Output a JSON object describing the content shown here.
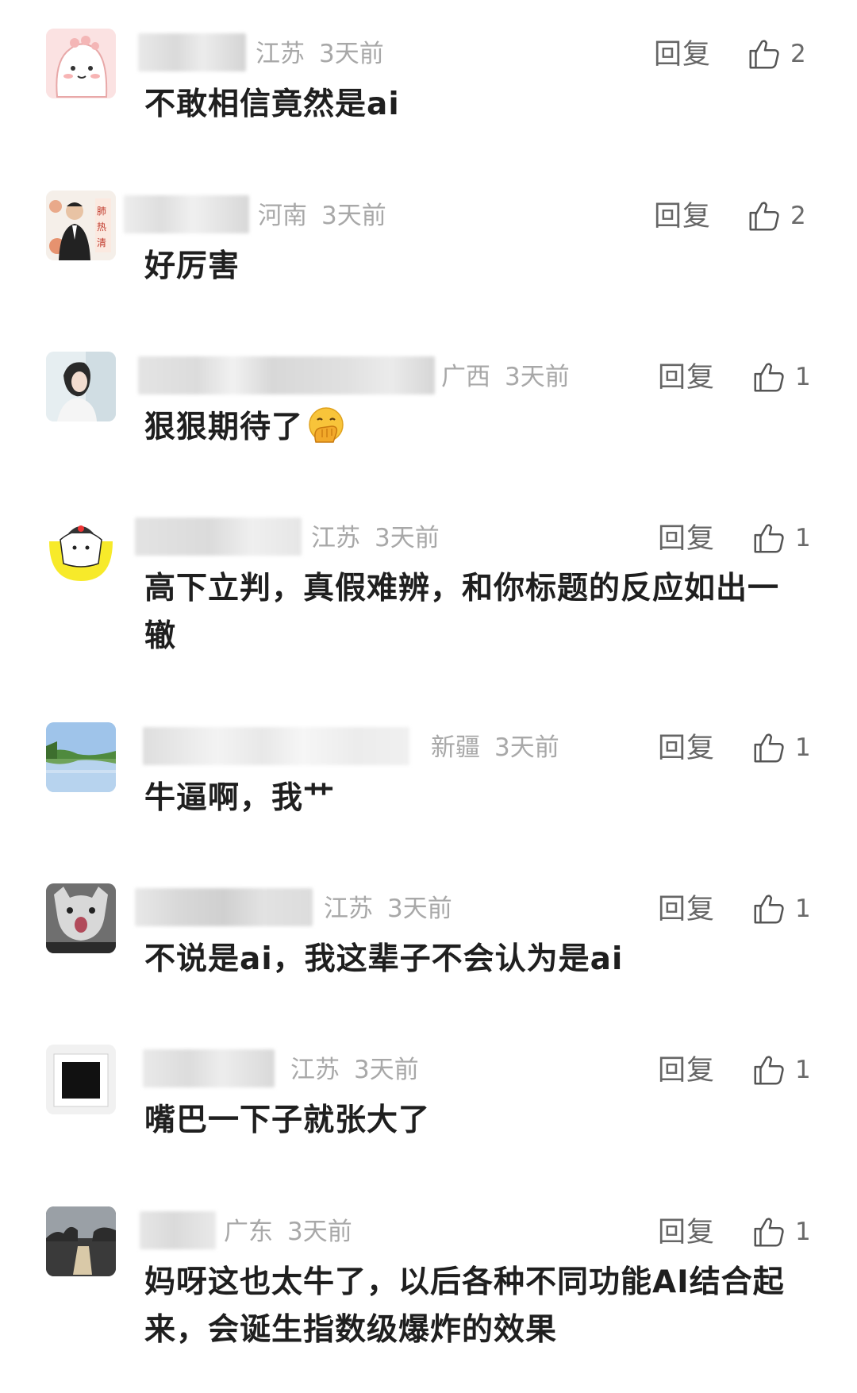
{
  "comments": [
    {
      "location": "江苏",
      "time": "3天前",
      "reply_label": "回复",
      "likes": "2",
      "text": "不敢相信竟然是ai",
      "avatar_icon": "cartoon-blob-avatar"
    },
    {
      "location": "河南",
      "time": "3天前",
      "reply_label": "回复",
      "likes": "2",
      "text": "好厉害",
      "avatar_icon": "man-in-suit-avatar"
    },
    {
      "location": "广西",
      "time": "3天前",
      "reply_label": "回复",
      "likes": "1",
      "text": "狠狠期待了",
      "emoji": "hand-over-mouth-emoji",
      "avatar_icon": "girl-photo-avatar"
    },
    {
      "location": "江苏",
      "time": "3天前",
      "reply_label": "回复",
      "likes": "1",
      "text": "高下立判，真假难辨，和你标题的反应如出一辙",
      "avatar_icon": "yellow-cartoon-avatar"
    },
    {
      "location": "新疆",
      "time": "3天前",
      "reply_label": "回复",
      "likes": "1",
      "text": "牛逼啊，我艹",
      "avatar_icon": "lake-landscape-avatar"
    },
    {
      "location": "江苏",
      "time": "3天前",
      "reply_label": "回复",
      "likes": "1",
      "text": "不说是ai，我这辈子不会认为是ai",
      "avatar_icon": "cat-meme-avatar"
    },
    {
      "location": "江苏",
      "time": "3天前",
      "reply_label": "回复",
      "likes": "1",
      "text": "嘴巴一下子就张大了",
      "avatar_icon": "black-square-avatar"
    },
    {
      "location": "广东",
      "time": "3天前",
      "reply_label": "回复",
      "likes": "1",
      "text": "妈呀这也太牛了，以后各种不同功能AI结合起来，会诞生指数级爆炸的效果",
      "avatar_icon": "dark-landscape-avatar"
    }
  ],
  "colors": {
    "meta_text": "#a8a8a8",
    "reply_text": "#666666",
    "content_text": "#1f1f1f",
    "like_icon": "#555555"
  }
}
